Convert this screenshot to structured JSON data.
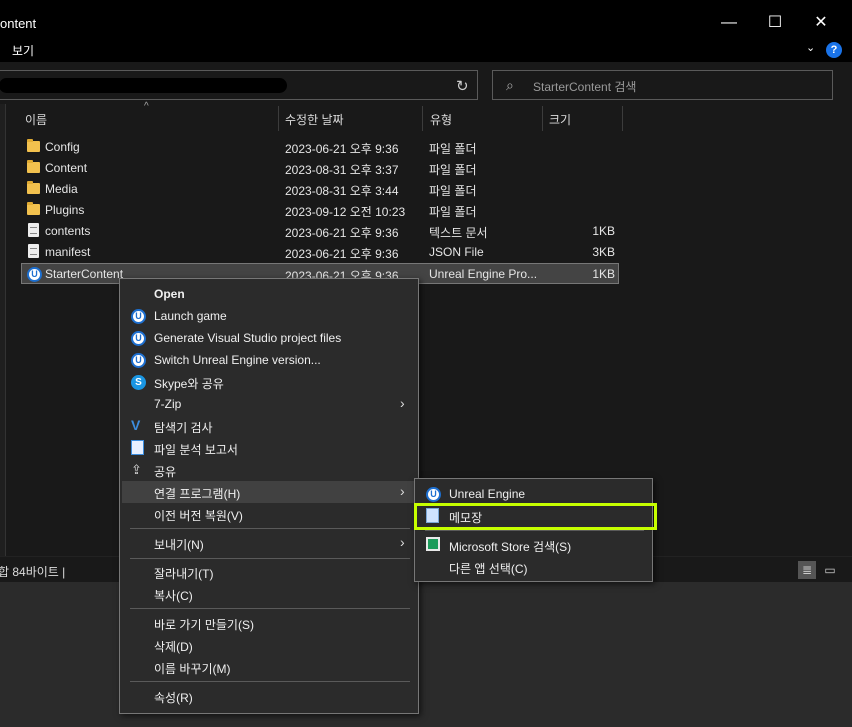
{
  "window": {
    "title": "ontent",
    "minimize": "—",
    "maximize": "☐",
    "close": "✕"
  },
  "menu": {
    "view_label": "보기",
    "expand": "⌄",
    "help": "?"
  },
  "address": {
    "refresh": "↻",
    "search_placeholder": "StarterContent 검색",
    "search_icon": "⌕"
  },
  "columns": {
    "name": "이름",
    "date": "수정한 날짜",
    "type": "유형",
    "size": "크기",
    "sort": "^"
  },
  "files": [
    {
      "name": "Config",
      "date": "2023-06-21 오후 9:36",
      "type": "파일 폴더",
      "size": "",
      "icon": "folder"
    },
    {
      "name": "Content",
      "date": "2023-08-31 오후 3:37",
      "type": "파일 폴더",
      "size": "",
      "icon": "folder"
    },
    {
      "name": "Media",
      "date": "2023-08-31 오후 3:44",
      "type": "파일 폴더",
      "size": "",
      "icon": "folder"
    },
    {
      "name": "Plugins",
      "date": "2023-09-12 오전 10:23",
      "type": "파일 폴더",
      "size": "",
      "icon": "folder"
    },
    {
      "name": "contents",
      "date": "2023-06-21 오후 9:36",
      "type": "텍스트 문서",
      "size": "1KB",
      "icon": "text-doc"
    },
    {
      "name": "manifest",
      "date": "2023-06-21 오후 9:36",
      "type": "JSON File",
      "size": "3KB",
      "icon": "json-doc"
    },
    {
      "name": "StarterContent",
      "date": "2023-06-21 오후 9:36",
      "type": "Unreal Engine Pro...",
      "size": "1KB",
      "icon": "unreal"
    }
  ],
  "status": {
    "text": "합 84바이트  |",
    "details_view": "≣",
    "preview": "▭"
  },
  "context_menu": {
    "open": "Open",
    "launch": "Launch game",
    "generate": "Generate Visual Studio project files",
    "switch": "Switch Unreal Engine version...",
    "skype": "Skype와 공유",
    "zip": "7-Zip",
    "scan": "탐색기 검사",
    "report": "파일 분석 보고서",
    "share": "공유",
    "open_with": "연결 프로그램(H)",
    "restore": "이전 버전 복원(V)",
    "send_to": "보내기(N)",
    "cut": "잘라내기(T)",
    "copy": "복사(C)",
    "shortcut": "바로 가기 만들기(S)",
    "delete": "삭제(D)",
    "rename": "이름 바꾸기(M)",
    "properties": "속성(R)",
    "arrow": "›"
  },
  "submenu": {
    "unreal": "Unreal Engine",
    "notepad": "메모장",
    "store": "Microsoft Store 검색(S)",
    "other": "다른 앱 선택(C)"
  },
  "colors": {
    "highlight_box": "#c6ff00",
    "folder": "#f2c14e",
    "unreal_blue": "#1d6fd0"
  }
}
